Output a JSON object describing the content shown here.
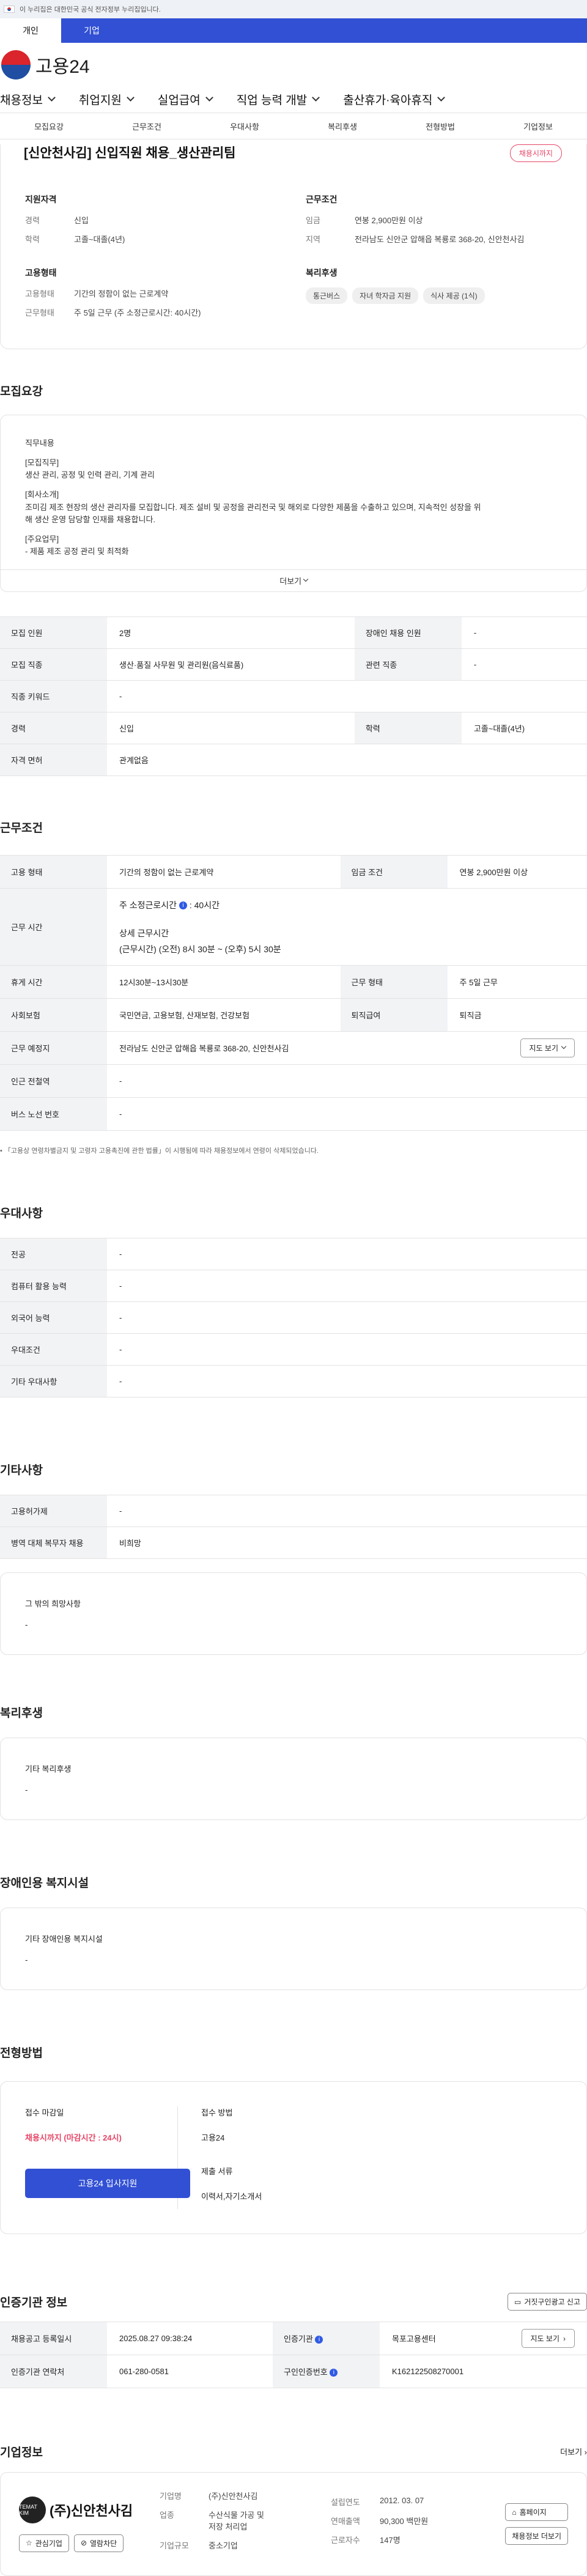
{
  "gov_banner": "이 누리집은 대한민국 공식 전자정부 누리집입니다.",
  "user_tabs": [
    "개인",
    "기업"
  ],
  "logo_text": "고용24",
  "gnb": [
    "채용정보",
    "취업지원",
    "실업급여",
    "직업 능력 개발",
    "출산휴가·육아휴직"
  ],
  "subtabs": [
    "모집요강",
    "근무조건",
    "우대사항",
    "복리후생",
    "전형방법",
    "기업정보"
  ],
  "job": {
    "title": "[신안천사김] 신입직원 채용_생산관리팀",
    "badge": "채용시까지",
    "qual_h": "지원자격",
    "career_k": "경력",
    "career_v": "신입",
    "edu_k": "학력",
    "edu_v": "고졸~대졸(4년)",
    "cond_h": "근무조건",
    "wage_k": "임금",
    "wage_v": "연봉 2,900만원 이상",
    "area_k": "지역",
    "area_v": "전라남도 신안군 압해읍 복룡로 368-20, 신안천사김",
    "emp_h": "고용형태",
    "emptype_k": "고용형태",
    "emptype_v": "기간의 정함이 없는 근로계약",
    "worktype_k": "근무형태",
    "worktype_v": "주 5일 근무 (주 소정근로시간: 40시간)",
    "welfare_h": "복리후생",
    "welfare": [
      "통근버스",
      "자녀 학자금 지원",
      "식사 제공 (1식)"
    ]
  },
  "recruit": {
    "heading": "모집요강",
    "desc_h": "직무내용",
    "l1": "[모집직무]",
    "l2": "생산 관리, 공정 및 인력 관리, 기계 관리",
    "l3": "[회사소개]",
    "l4": "조미김 제조 현장의 생산 관리자를 모집합니다. 제조 설비 및 공정을 관리전국 및 해외로 다양한 제품을 수출하고 있으며, 지속적인 성장을 위",
    "l5": "해 생산 운영 담당할 인재를 채용합니다.",
    "l6": "[주요업무]",
    "l7": "- 제품 제조 공정 관리 및 최적화",
    "more": "더보기",
    "rows": [
      [
        "모집 인원",
        "2명",
        "장애인 채용 인원",
        "-"
      ],
      [
        "모집 직종",
        "생산·품질 사무원 및 관리원(음식료품)",
        "관련 직종",
        "-"
      ],
      [
        "직종 키워드",
        "-"
      ],
      [
        "경력",
        "신입",
        "학력",
        "고졸~대졸(4년)"
      ],
      [
        "자격 면허",
        "관계없음"
      ]
    ]
  },
  "work": {
    "heading": "근무조건",
    "type_k": "고용 형태",
    "type_v": "기간의 정함이 없는 근로계약",
    "wage_k": "임금 조건",
    "wage_v": "연봉 2,900만원 이상",
    "time_k": "근무 시간",
    "time_a": "주 소정근로시간",
    "time_b": ": 40시간",
    "time_c": "상세 근무시간",
    "time_d": "(근무시간) (오전) 8시 30분 ~ (오후) 5시 30분",
    "rest_k": "휴게 시간",
    "rest_v": "12시30분~13시30분",
    "form_k": "근무 형태",
    "form_v": "주 5일 근무",
    "ins_k": "사회보험",
    "ins_v": "국민연금, 고용보험, 산재보험, 건강보험",
    "ret_k": "퇴직급여",
    "ret_v": "퇴직금",
    "place_k": "근무 예정지",
    "place_v": "전라남도 신안군 압해읍 복룡로 368-20, 신안천사김",
    "map": "지도 보기",
    "sub_k": "인근 전철역",
    "sub_v": "-",
    "bus_k": "버스 노선 번호",
    "bus_v": "-",
    "note": "「고용상 연령차별금지 및 고령자 고용촉진에 관한 법률」이 시행됨에 따라 채용정보에서 연령이 삭제되었습니다."
  },
  "pref": {
    "heading": "우대사항",
    "rows": [
      [
        "전공",
        "-"
      ],
      [
        "컴퓨터 활용 능력",
        "-"
      ],
      [
        "외국어 능력",
        "-"
      ],
      [
        "우대조건",
        "-"
      ],
      [
        "기타 우대사항",
        "-"
      ]
    ]
  },
  "etc": {
    "heading": "기타사항",
    "rows": [
      [
        "고용허가제",
        "-"
      ],
      [
        "병역 대체 복무자 채용",
        "비희망"
      ]
    ],
    "hope_h": "그 밖의 희망사항",
    "hope_v": "-"
  },
  "welfare": {
    "heading": "복리후생",
    "h": "기타 복리후생",
    "v": "-"
  },
  "facility": {
    "heading": "장애인용 복지시설",
    "h": "기타 장애인용 복지시설",
    "v": "-"
  },
  "process": {
    "heading": "전형방법",
    "deadline_h": "접수 마감일",
    "deadline_v": "채용시까지 (마감시간 : 24시)",
    "apply": "고용24 입사지원",
    "method_h": "접수 방법",
    "method_v": "고용24",
    "docs_h": "제출 서류",
    "docs_v": "이력서,자기소개서"
  },
  "agency": {
    "heading": "인증기관 정보",
    "report": "거짓구인광고 신고",
    "reg_k": "채용공고 등록일시",
    "reg_v": "2025.08.27 09:38:24",
    "org_k": "인증기관",
    "org_v": "목포고용센터",
    "map": "지도 보기",
    "contact_k": "인증기관 연락처",
    "contact_v": "061-280-0581",
    "num_k": "구인인증번호",
    "num_v": "K162122508270001"
  },
  "company": {
    "heading": "기업정보",
    "more": "더보기",
    "logo_sub": "TEMAT KIM",
    "logo_name": "(주)신안천사김",
    "fav": "관심기업",
    "block": "열람차단",
    "name_k": "기업명",
    "name_v": "(주)신안천사김",
    "ind_k": "업종",
    "ind_v1": "수산식물 가공 및",
    "ind_v2": "저장 처리업",
    "size_k": "기업규모",
    "size_v": "중소기업",
    "est_k": "설립연도",
    "est_v": "2012. 03. 07",
    "rev_k": "연매출액",
    "rev_v": "90,300 백만원",
    "emp_k": "근로자수",
    "emp_v": "147명",
    "home": "홈페이지",
    "jobs": "채용정보 더보기"
  },
  "colors": {
    "primary": "#3150d4",
    "accent_red": "#e64566"
  }
}
